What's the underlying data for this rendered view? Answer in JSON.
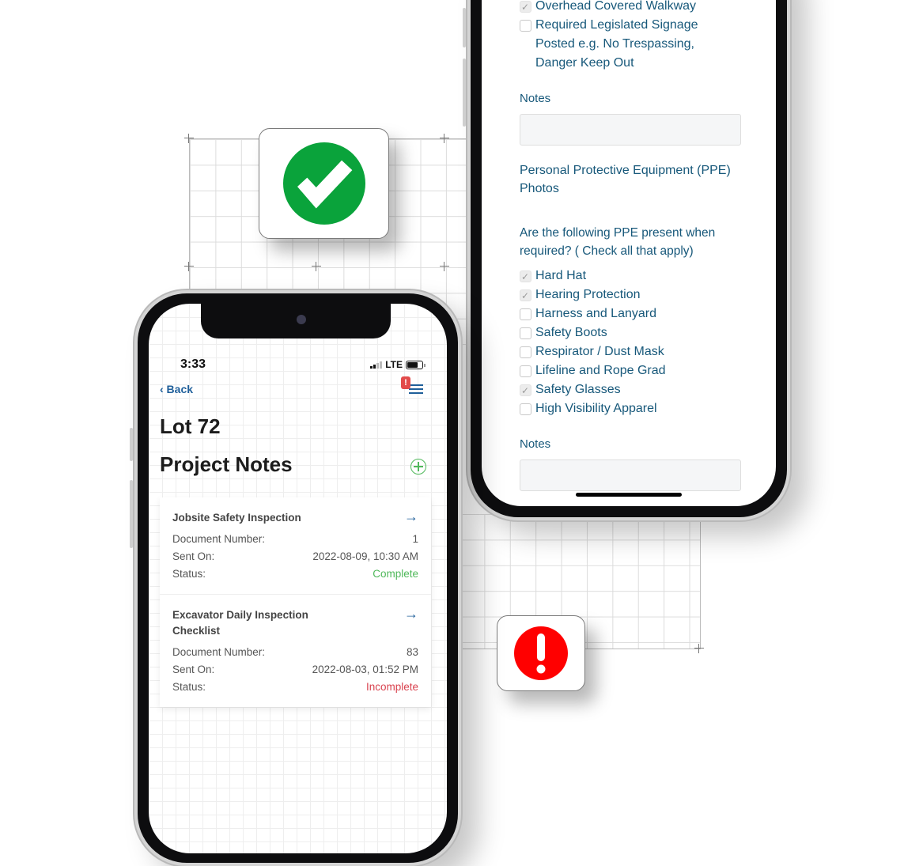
{
  "decorations": {
    "success_badge_icon": "check-circle-icon",
    "alert_badge_icon": "exclamation-circle-icon",
    "colors": {
      "success": "#0aa33b",
      "alert": "#ff0000",
      "brand_blue": "#17587a",
      "complete": "#4fb85a",
      "incomplete": "#d9434f"
    }
  },
  "checklist_form": {
    "previous_item": {
      "label": "Overhead Covered Walkway",
      "checked": true
    },
    "signage_item": {
      "label": "Required Legislated Signage Posted e.g. No Trespassing, Danger Keep Out",
      "checked": false
    },
    "notes_label_1": "Notes",
    "notes_value_1": "",
    "ppe_photos_label": "Personal Protective Equipment (PPE) Photos",
    "ppe_question": "Are the following PPE present when required? ( Check all that apply)",
    "ppe_items": [
      {
        "label": "Hard Hat",
        "checked": true
      },
      {
        "label": "Hearing Protection",
        "checked": true
      },
      {
        "label": "Harness and Lanyard",
        "checked": false
      },
      {
        "label": "Safety Boots",
        "checked": false
      },
      {
        "label": "Respirator / Dust Mask",
        "checked": false
      },
      {
        "label": "Lifeline and Rope Grad",
        "checked": false
      },
      {
        "label": "Safety Glasses",
        "checked": true
      },
      {
        "label": "High Visibility Apparel",
        "checked": false
      }
    ],
    "notes_label_2": "Notes",
    "notes_value_2": ""
  },
  "project_notes": {
    "status_bar": {
      "time": "3:33",
      "network": "LTE"
    },
    "nav": {
      "back_label": "‹ Back",
      "menu_alert": "!"
    },
    "project_title": "Lot 72",
    "section_title": "Project Notes",
    "labels": {
      "document_number": "Document Number:",
      "sent_on": "Sent On:",
      "status": "Status:"
    },
    "documents": [
      {
        "title": "Jobsite Safety Inspection",
        "document_number": "1",
        "sent_on": "2022-08-09, 10:30 AM",
        "status": "Complete"
      },
      {
        "title": "Excavator Daily Inspection Checklist",
        "document_number": "83",
        "sent_on": "2022-08-03, 01:52 PM",
        "status": "Incomplete"
      }
    ]
  }
}
